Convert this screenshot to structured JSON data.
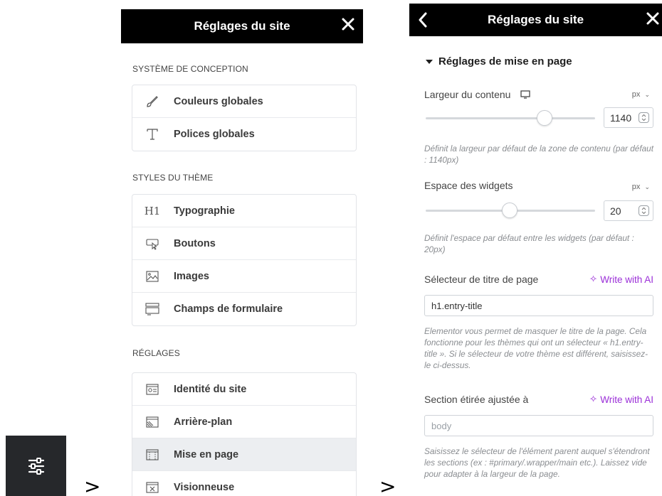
{
  "separators": [
    ">",
    ">"
  ],
  "panel1": {
    "title": "Réglages du site",
    "sections": [
      {
        "label": "SYSTÈME DE CONCEPTION",
        "items": [
          {
            "icon": "brush-icon",
            "label": "Couleurs globales"
          },
          {
            "icon": "font-t-icon",
            "label": "Polices globales"
          }
        ]
      },
      {
        "label": "STYLES DU THÈME",
        "items": [
          {
            "icon": "h1-icon",
            "label": "Typographie"
          },
          {
            "icon": "button-cursor-icon",
            "label": "Boutons"
          },
          {
            "icon": "image-icon",
            "label": "Images"
          },
          {
            "icon": "form-fields-icon",
            "label": "Champs de formulaire"
          }
        ]
      },
      {
        "label": "RÉGLAGES",
        "items": [
          {
            "icon": "site-identity-icon",
            "label": "Identité du site"
          },
          {
            "icon": "background-icon",
            "label": "Arrière-plan"
          },
          {
            "icon": "layout-icon",
            "label": "Mise en page",
            "active": true
          },
          {
            "icon": "lightbox-icon",
            "label": "Visionneuse"
          }
        ]
      }
    ],
    "h1_glyph": "H1"
  },
  "panel2": {
    "title": "Réglages du site",
    "section_title": "Réglages de mise en page",
    "content_width": {
      "label": "Largeur du contenu",
      "unit": "px",
      "value": "1140",
      "slider_fraction": 0.72,
      "help": "Définit la largeur par défaut de la zone de contenu (par défaut : 1140px)"
    },
    "widgets_space": {
      "label": "Espace des widgets",
      "unit": "px",
      "value": "20",
      "slider_fraction": 0.49,
      "help": "Définit l'espace par défaut entre les widgets (par défaut : 20px)"
    },
    "page_title_selector": {
      "label": "Sélecteur de titre de page",
      "ai_label": "Write with AI",
      "value": "h1.entry-title",
      "help": "Elementor vous permet de masquer le titre de la page. Cela fonctionne pour les thèmes qui ont un sélecteur « h1.entry-title ». Si le sélecteur de votre thème est différent, saisissez-le ci-dessus."
    },
    "stretched_section": {
      "label": "Section étirée ajustée à",
      "ai_label": "Write with AI",
      "placeholder": "body",
      "help": "Saisissez le sélecteur de l'élément parent auquel s'étendront les sections (ex : #primary/.wrapper/main etc.). Laissez vide pour adapter à la largeur de la page."
    }
  }
}
